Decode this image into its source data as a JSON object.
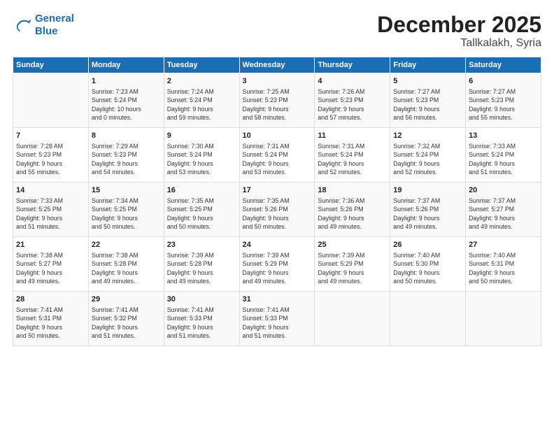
{
  "logo": {
    "line1": "General",
    "line2": "Blue"
  },
  "title": "December 2025",
  "subtitle": "Tallkalakh, Syria",
  "days_header": [
    "Sunday",
    "Monday",
    "Tuesday",
    "Wednesday",
    "Thursday",
    "Friday",
    "Saturday"
  ],
  "weeks": [
    [
      {
        "day": "",
        "info": ""
      },
      {
        "day": "1",
        "info": "Sunrise: 7:23 AM\nSunset: 5:24 PM\nDaylight: 10 hours\nand 0 minutes."
      },
      {
        "day": "2",
        "info": "Sunrise: 7:24 AM\nSunset: 5:24 PM\nDaylight: 9 hours\nand 59 minutes."
      },
      {
        "day": "3",
        "info": "Sunrise: 7:25 AM\nSunset: 5:23 PM\nDaylight: 9 hours\nand 58 minutes."
      },
      {
        "day": "4",
        "info": "Sunrise: 7:26 AM\nSunset: 5:23 PM\nDaylight: 9 hours\nand 57 minutes."
      },
      {
        "day": "5",
        "info": "Sunrise: 7:27 AM\nSunset: 5:23 PM\nDaylight: 9 hours\nand 56 minutes."
      },
      {
        "day": "6",
        "info": "Sunrise: 7:27 AM\nSunset: 5:23 PM\nDaylight: 9 hours\nand 55 minutes."
      }
    ],
    [
      {
        "day": "7",
        "info": "Sunrise: 7:28 AM\nSunset: 5:23 PM\nDaylight: 9 hours\nand 55 minutes."
      },
      {
        "day": "8",
        "info": "Sunrise: 7:29 AM\nSunset: 5:23 PM\nDaylight: 9 hours\nand 54 minutes."
      },
      {
        "day": "9",
        "info": "Sunrise: 7:30 AM\nSunset: 5:24 PM\nDaylight: 9 hours\nand 53 minutes."
      },
      {
        "day": "10",
        "info": "Sunrise: 7:31 AM\nSunset: 5:24 PM\nDaylight: 9 hours\nand 53 minutes."
      },
      {
        "day": "11",
        "info": "Sunrise: 7:31 AM\nSunset: 5:24 PM\nDaylight: 9 hours\nand 52 minutes."
      },
      {
        "day": "12",
        "info": "Sunrise: 7:32 AM\nSunset: 5:24 PM\nDaylight: 9 hours\nand 52 minutes."
      },
      {
        "day": "13",
        "info": "Sunrise: 7:33 AM\nSunset: 5:24 PM\nDaylight: 9 hours\nand 51 minutes."
      }
    ],
    [
      {
        "day": "14",
        "info": "Sunrise: 7:33 AM\nSunset: 5:25 PM\nDaylight: 9 hours\nand 51 minutes."
      },
      {
        "day": "15",
        "info": "Sunrise: 7:34 AM\nSunset: 5:25 PM\nDaylight: 9 hours\nand 50 minutes."
      },
      {
        "day": "16",
        "info": "Sunrise: 7:35 AM\nSunset: 5:25 PM\nDaylight: 9 hours\nand 50 minutes."
      },
      {
        "day": "17",
        "info": "Sunrise: 7:35 AM\nSunset: 5:26 PM\nDaylight: 9 hours\nand 50 minutes."
      },
      {
        "day": "18",
        "info": "Sunrise: 7:36 AM\nSunset: 5:26 PM\nDaylight: 9 hours\nand 49 minutes."
      },
      {
        "day": "19",
        "info": "Sunrise: 7:37 AM\nSunset: 5:26 PM\nDaylight: 9 hours\nand 49 minutes."
      },
      {
        "day": "20",
        "info": "Sunrise: 7:37 AM\nSunset: 5:27 PM\nDaylight: 9 hours\nand 49 minutes."
      }
    ],
    [
      {
        "day": "21",
        "info": "Sunrise: 7:38 AM\nSunset: 5:27 PM\nDaylight: 9 hours\nand 49 minutes."
      },
      {
        "day": "22",
        "info": "Sunrise: 7:38 AM\nSunset: 5:28 PM\nDaylight: 9 hours\nand 49 minutes."
      },
      {
        "day": "23",
        "info": "Sunrise: 7:39 AM\nSunset: 5:28 PM\nDaylight: 9 hours\nand 49 minutes."
      },
      {
        "day": "24",
        "info": "Sunrise: 7:39 AM\nSunset: 5:29 PM\nDaylight: 9 hours\nand 49 minutes."
      },
      {
        "day": "25",
        "info": "Sunrise: 7:39 AM\nSunset: 5:29 PM\nDaylight: 9 hours\nand 49 minutes."
      },
      {
        "day": "26",
        "info": "Sunrise: 7:40 AM\nSunset: 5:30 PM\nDaylight: 9 hours\nand 50 minutes."
      },
      {
        "day": "27",
        "info": "Sunrise: 7:40 AM\nSunset: 5:31 PM\nDaylight: 9 hours\nand 50 minutes."
      }
    ],
    [
      {
        "day": "28",
        "info": "Sunrise: 7:41 AM\nSunset: 5:31 PM\nDaylight: 9 hours\nand 50 minutes."
      },
      {
        "day": "29",
        "info": "Sunrise: 7:41 AM\nSunset: 5:32 PM\nDaylight: 9 hours\nand 51 minutes."
      },
      {
        "day": "30",
        "info": "Sunrise: 7:41 AM\nSunset: 5:33 PM\nDaylight: 9 hours\nand 51 minutes."
      },
      {
        "day": "31",
        "info": "Sunrise: 7:41 AM\nSunset: 5:33 PM\nDaylight: 9 hours\nand 51 minutes."
      },
      {
        "day": "",
        "info": ""
      },
      {
        "day": "",
        "info": ""
      },
      {
        "day": "",
        "info": ""
      }
    ]
  ]
}
